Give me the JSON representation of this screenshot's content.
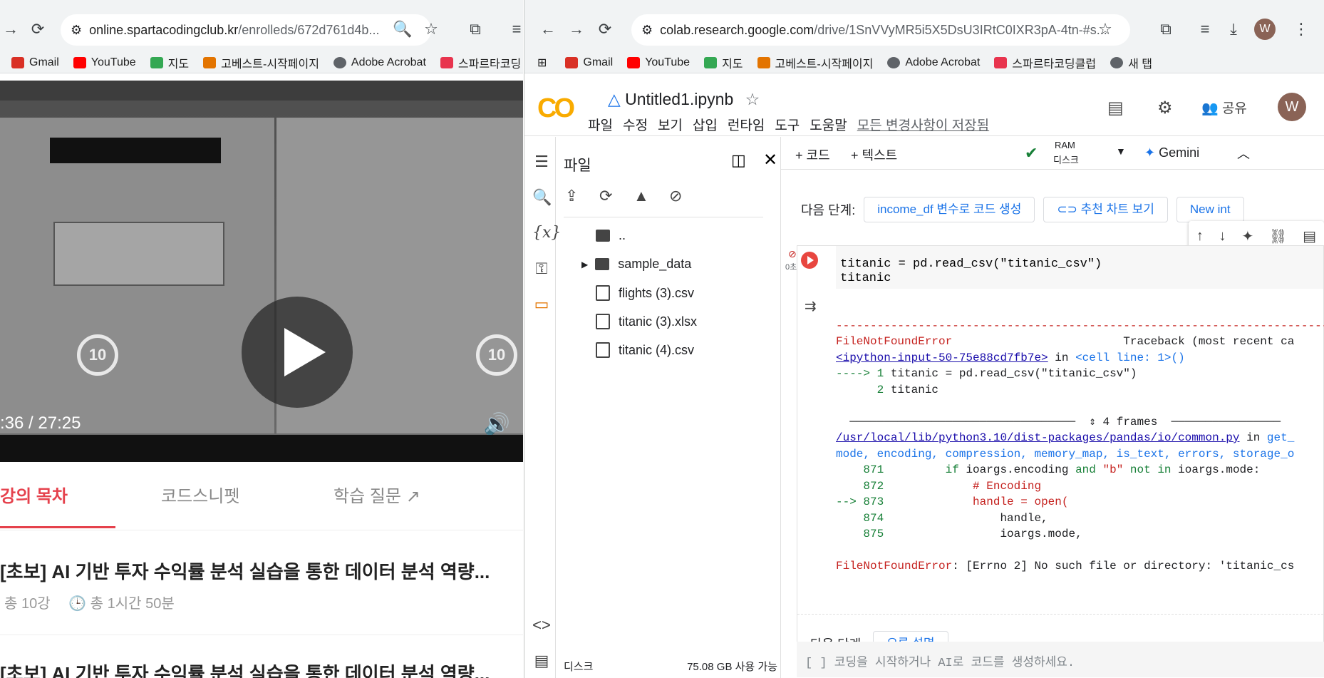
{
  "left_window": {
    "url_host": "online.spartacodingclub.kr",
    "url_path": "/enrolleds/672d761d4b...",
    "bookmarks": [
      "Gmail",
      "YouTube",
      "지도",
      "고베스트-시작페이지",
      "Adobe Acrobat",
      "스파르타코딩"
    ],
    "video": {
      "skip_back": "10",
      "skip_forward": "10",
      "current_time": ":36",
      "separator": "/",
      "duration": "27:25"
    },
    "tabs": {
      "toc": "강의 목차",
      "snippets": "코드스니펫",
      "questions": "학습 질문"
    },
    "courses": [
      {
        "title": "[초보] AI 기반 투자 수익률 분석 실습을 통한 데이터 분석 역량...",
        "lessons": "총 10강",
        "duration": "총 1시간 50분"
      },
      {
        "title": "[초보] AI 기반 투자 수익률 분석 실습을 통한 데이터 분석 역량..."
      }
    ]
  },
  "right_window": {
    "url_host": "colab.research.google.com",
    "url_path": "/drive/1SnVVyMR5i5X5DsU3IRtC0IXR3pA-4tn-#s...",
    "bookmarks": [
      "Gmail",
      "YouTube",
      "지도",
      "고베스트-시작페이지",
      "Adobe Acrobat",
      "스파르타코딩클럽",
      "새 탭"
    ],
    "notebook_title": "Untitled1.ipynb",
    "menu": [
      "파일",
      "수정",
      "보기",
      "삽입",
      "런타임",
      "도구",
      "도움말"
    ],
    "saved_status": "모든 변경사항이 저장됨",
    "share_label": "공유",
    "avatar_letter": "W",
    "files_panel": {
      "title": "파일",
      "entries": [
        "..",
        "sample_data",
        "flights (3).csv",
        "titanic (3).xlsx",
        "titanic (4).csv"
      ],
      "disk_label": "디스크",
      "disk_free": "75.08 GB 사용 가능"
    },
    "toolbar": {
      "add_code": "+ 코드",
      "add_text": "+ 텍스트",
      "ram_label": "RAM",
      "disk_label": "디스크",
      "gemini": "Gemini"
    },
    "next_steps_label": "다음 단계:",
    "next_step_chips": [
      "income_df 변수로 코드 생성",
      "추천 차트 보기",
      "New int"
    ],
    "cell": {
      "exec_count": "0초",
      "code_line1": "titanic = pd.read_csv(\"titanic_csv\")",
      "code_line2": "titanic",
      "frames_label": "4 frames",
      "error_explain": "오류 설명"
    },
    "empty_cell_prompt": "[ ]  코딩을 시작하거나 AI로 코드를 생성하세요."
  }
}
